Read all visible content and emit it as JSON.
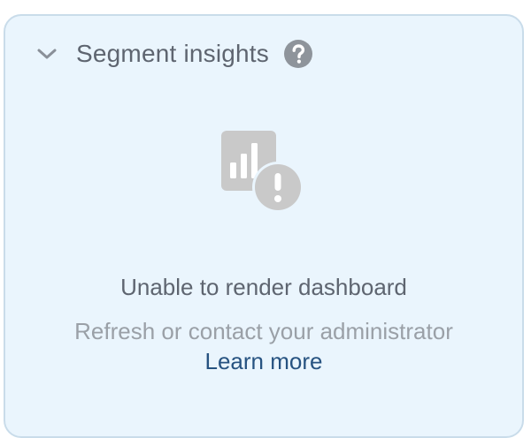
{
  "panel": {
    "title": "Segment insights",
    "icons": {
      "toggle": "chevron-down-icon",
      "help": "help-circle-icon",
      "state": "chart-error-icon"
    }
  },
  "empty_state": {
    "heading": "Unable to render dashboard",
    "message": "Refresh or contact your administrator",
    "link_label": "Learn more"
  },
  "colors": {
    "panel_background": "#eaf5fd",
    "panel_border": "#c9dcea",
    "text_primary": "#5e6570",
    "text_secondary": "#9aa0a7",
    "link": "#275381",
    "icon_gray": "#c9c9c9"
  }
}
